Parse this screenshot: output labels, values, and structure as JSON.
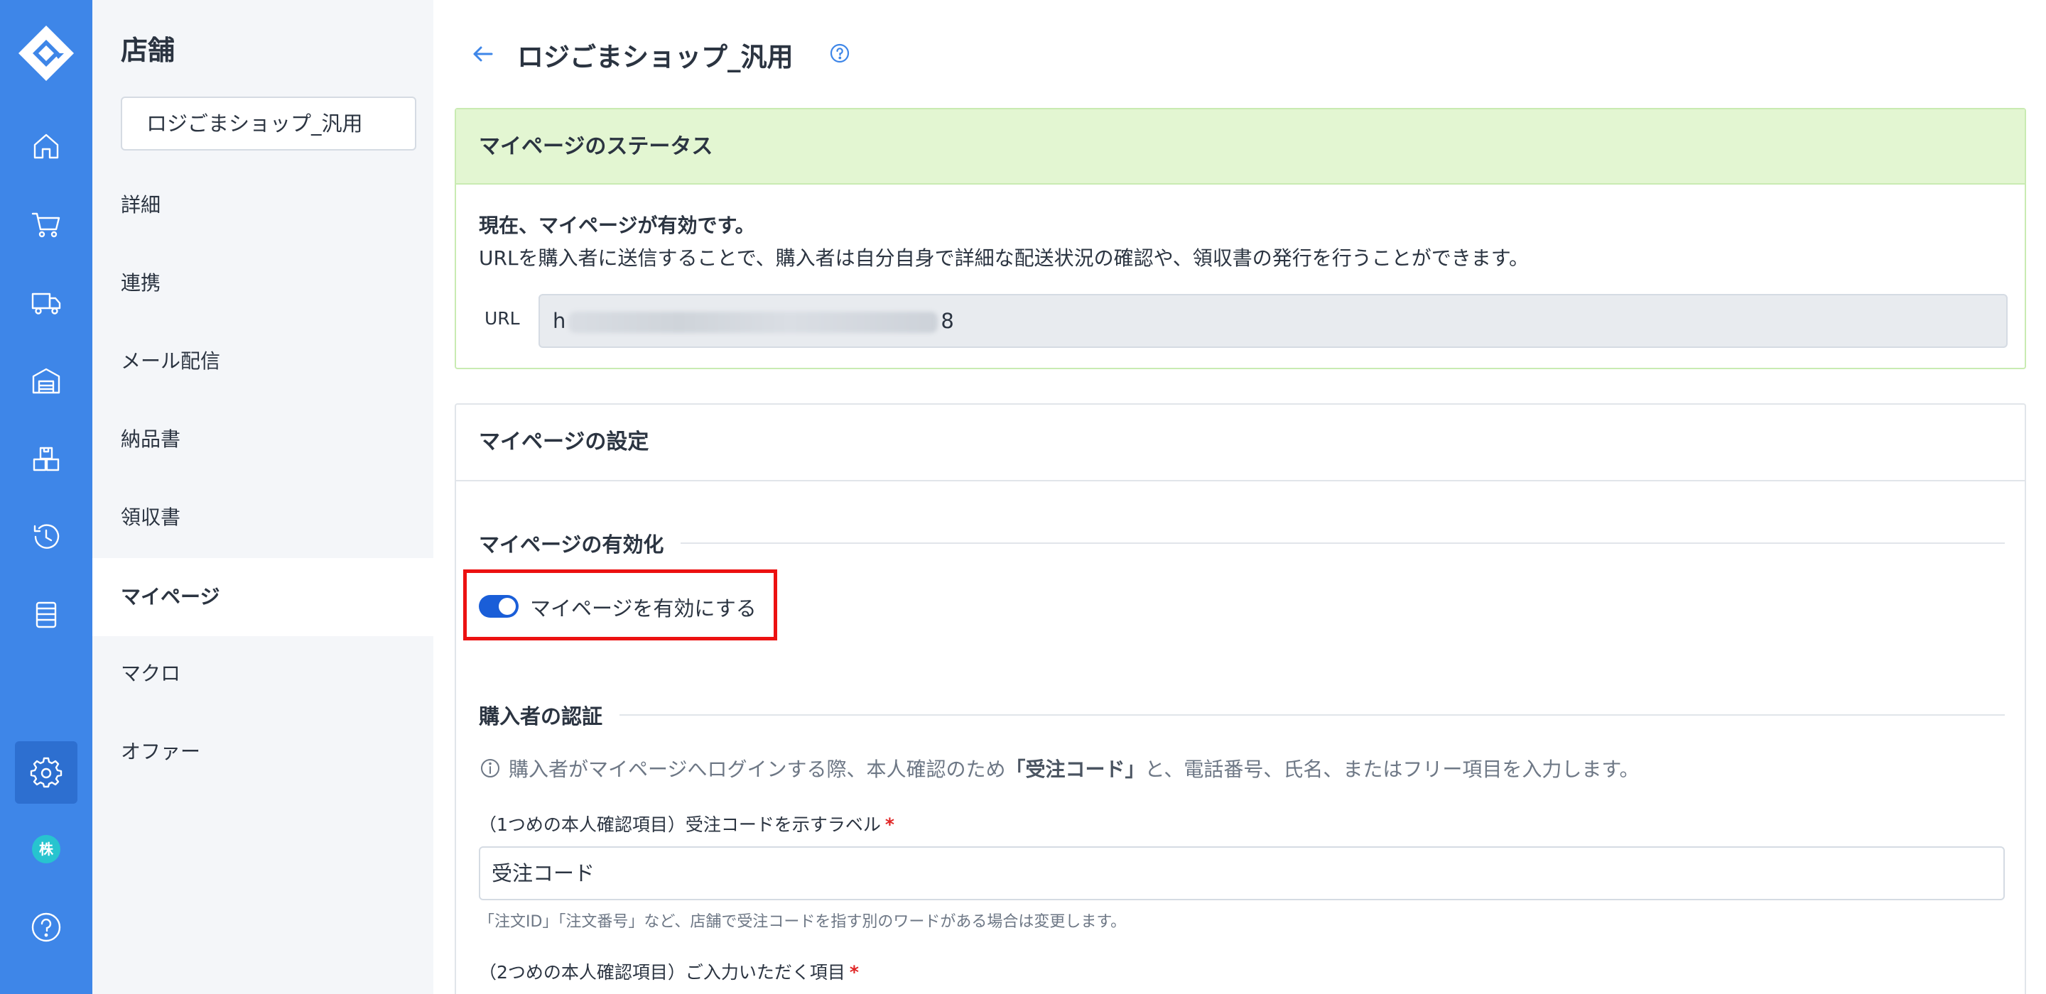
{
  "colors": {
    "rail_bg": "#3e86e8",
    "rail_active": "#2d6fd0",
    "sidebar_bg": "#f4f6f9",
    "status_header_bg": "#e3f6d2",
    "status_border": "#c9ebb2",
    "toggle_on": "#1a5ed8",
    "highlight_border": "#ec1111",
    "required": "#e02424"
  },
  "rail": {
    "items": [
      {
        "name": "home-icon"
      },
      {
        "name": "cart-icon"
      },
      {
        "name": "truck-icon"
      },
      {
        "name": "warehouse-icon"
      },
      {
        "name": "boxes-icon"
      },
      {
        "name": "history-icon"
      },
      {
        "name": "list-icon"
      },
      {
        "name": "gear-icon",
        "active": true
      },
      {
        "name": "company-avatar-icon",
        "label": "株"
      },
      {
        "name": "help-icon"
      }
    ]
  },
  "sidebar": {
    "title": "店舗",
    "store_select": "ロジごまショップ_汎用",
    "items": [
      {
        "label": "詳細"
      },
      {
        "label": "連携"
      },
      {
        "label": "メール配信"
      },
      {
        "label": "納品書"
      },
      {
        "label": "領収書"
      },
      {
        "label": "マイページ",
        "active": true
      },
      {
        "label": "マクロ"
      },
      {
        "label": "オファー"
      }
    ]
  },
  "header": {
    "title": "ロジごまショップ_汎用"
  },
  "status_card": {
    "title": "マイページのステータス",
    "status_strong": "現在、マイページが有効です。",
    "status_desc": "URLを購入者に送信することで、購入者は自分自身で詳細な配送状況の確認や、領収書の発行を行うことができます。",
    "url_label": "URL",
    "url_start": "h",
    "url_end": "8"
  },
  "settings_card": {
    "title": "マイページの設定",
    "enable_section": "マイページの有効化",
    "toggle_label": "マイページを有効にする",
    "toggle_on": true,
    "auth_section": "購入者の認証",
    "info_pre": "購入者がマイページへログインする際、本人確認のため",
    "info_bold": "「受注コード」",
    "info_post": "と、電話番号、氏名、またはフリー項目を入力します。",
    "field1_label": "（1つめの本人確認項目）受注コードを示すラベル",
    "field1_value": "受注コード",
    "field1_hint": "「注文ID」「注文番号」など、店舗で受注コードを指す別のワードがある場合は変更します。",
    "field2_label": "（2つめの本人確認項目）ご入力いただく項目",
    "required_mark": "*"
  }
}
